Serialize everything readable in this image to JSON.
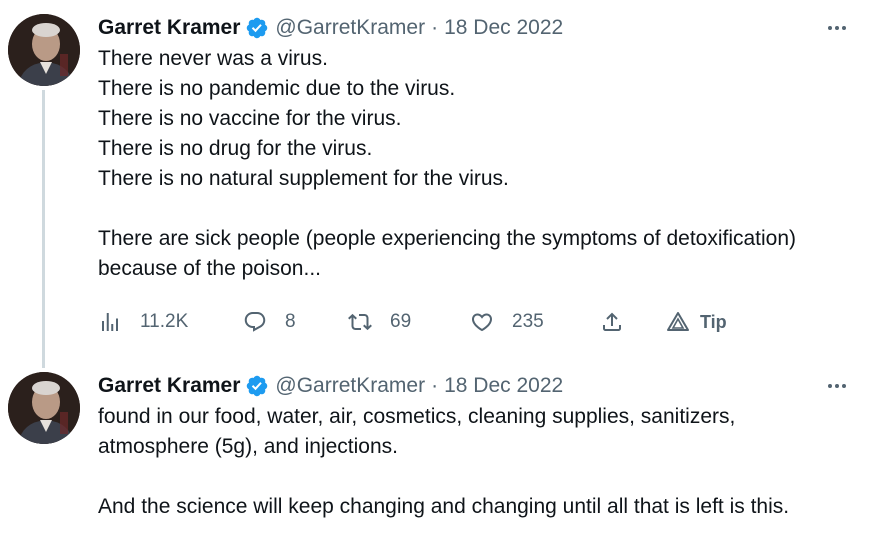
{
  "tweets": [
    {
      "author": {
        "display_name": "Garret Kramer",
        "handle": "@GarretKramer",
        "verified": true
      },
      "separator": "·",
      "date": "18 Dec 2022",
      "lines": [
        "There never was a virus.",
        "There is no pandemic due to the virus.",
        "There is no vaccine for the virus.",
        "There is no drug for the virus.",
        "There is no natural supplement for the virus.",
        "",
        "There are sick people (people experiencing the symptoms of detoxification)",
        "because of the poison..."
      ],
      "metrics": {
        "views": "11.2K",
        "replies": "8",
        "retweets": "69",
        "likes": "235",
        "tip_label": "Tip"
      }
    },
    {
      "author": {
        "display_name": "Garret Kramer",
        "handle": "@GarretKramer",
        "verified": true
      },
      "separator": "·",
      "date": "18 Dec 2022",
      "lines": [
        "found in our food, water, air, cosmetics, cleaning supplies, sanitizers,",
        "atmosphere (5g), and injections.",
        "",
        "And the science will keep changing and changing until all that is left is this."
      ]
    }
  ],
  "icons": {
    "verified": "verified-badge-icon",
    "more": "more-dots-icon",
    "views": "views-bars-icon",
    "reply": "reply-bubble-icon",
    "retweet": "retweet-arrows-icon",
    "like": "heart-icon",
    "share": "share-upload-icon",
    "tip": "tip-triangle-icon"
  },
  "colors": {
    "text_primary": "#0f1419",
    "text_secondary": "#536471",
    "verified_blue": "#1d9bf0",
    "thread_line": "#cfd9de",
    "background": "#ffffff"
  }
}
